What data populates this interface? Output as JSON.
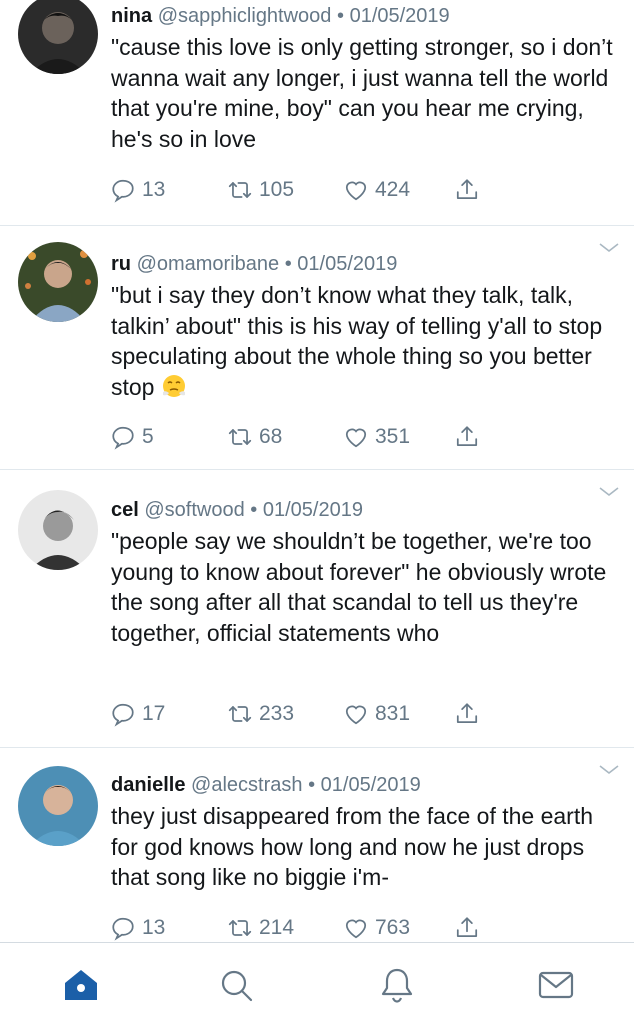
{
  "tweets": [
    {
      "name": "nina",
      "handle": "@sapphiclightwood",
      "dot": "•",
      "date": "01/05/2019",
      "text": "\"cause this love is only getting stronger, so i don’t wanna wait any longer, i just wanna tell the world that you're mine, boy\" can you hear me crying, he's so in love",
      "replies": "13",
      "retweets": "105",
      "likes": "424"
    },
    {
      "name": "ru",
      "handle": "@omamoribane",
      "dot": "•",
      "date": "01/05/2019",
      "text": "\"but i say they don’t know what they talk, talk, talkin’ about\" this is his way of telling y'all to stop speculating about the whole thing so you better stop",
      "emoji": "steam-from-nose-emoji",
      "replies": "5",
      "retweets": "68",
      "likes": "351"
    },
    {
      "name": "cel",
      "handle": "@softwood",
      "dot": "•",
      "date": "01/05/2019",
      "text": "\"people say we shouldn’t be together, we're too young to know about forever\" he obviously wrote the song after all that scandal to tell us they're together, official statements who",
      "replies": "17",
      "retweets": "233",
      "likes": "831"
    },
    {
      "name": "danielle",
      "handle": "@alecstrash",
      "dot": "•",
      "date": "01/05/2019",
      "text": "they just disappeared from the face of the earth for god knows how long and now he just drops that song like no biggie i'm-",
      "replies": "13",
      "retweets": "214",
      "likes": "763"
    }
  ],
  "icons": {
    "reply": "reply-icon",
    "retweet": "retweet-icon",
    "like": "heart-icon",
    "share": "share-icon",
    "caret": "chevron-down-icon"
  },
  "tabbar": {
    "items": [
      "home-icon",
      "search-icon",
      "notifications-icon",
      "messages-icon"
    ],
    "active": "home"
  },
  "colors": {
    "accent": "#1da1f2",
    "active_tab": "#1b5fa8",
    "muted": "#657786",
    "text": "#14171a"
  }
}
